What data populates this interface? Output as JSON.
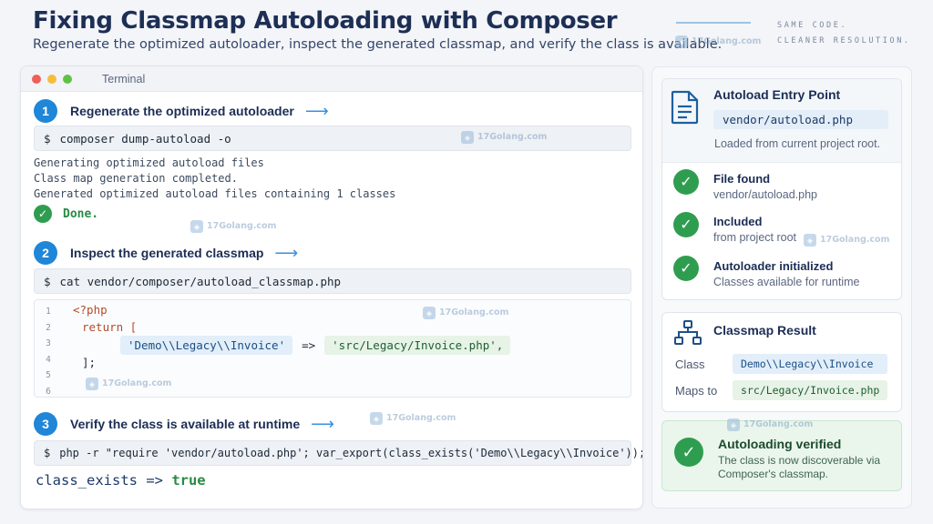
{
  "header": {
    "title": "Fixing Classmap Autoloading with Composer",
    "subtitle": "Regenerate the optimized autoloader, inspect the generated classmap, and verify the class is available.",
    "tagline_line1": "SAME CODE.",
    "tagline_line2": "CLEANER RESOLUTION."
  },
  "watermark": "17Golang.com",
  "terminal": {
    "title": "Terminal",
    "prompt": "$",
    "steps": [
      {
        "num": "1",
        "label": "Regenerate the optimized autoloader",
        "command": "composer dump-autoload -o"
      },
      {
        "num": "2",
        "label": "Inspect the generated classmap",
        "command": "cat vendor/composer/autoload_classmap.php"
      },
      {
        "num": "3",
        "label": "Verify the class is available at runtime",
        "command": "php -r \"require 'vendor/autoload.php'; var_export(class_exists('Demo\\\\Legacy\\\\Invoice'));\""
      }
    ],
    "output_lines": [
      "Generating optimized autoload files",
      "Class map generation completed.",
      "Generated optimized autoload files containing 1 classes"
    ],
    "done_label": "Done.",
    "code": {
      "line_numbers": [
        "1",
        "2",
        "3",
        "4",
        "5",
        "6"
      ],
      "line1": "<?php",
      "line2": "return [",
      "key": "'Demo\\\\Legacy\\\\Invoice'",
      "arrow": "=>",
      "value": "'src/Legacy/Invoice.php',",
      "line4": "];"
    },
    "result_prefix": "class_exists => ",
    "result_value": "true"
  },
  "entry_point": {
    "title": "Autoload Entry Point",
    "file": "vendor/autoload.php",
    "note": "Loaded from current project root.",
    "checks": [
      {
        "title": "File found",
        "detail": "vendor/autoload.php"
      },
      {
        "title": "Included",
        "detail": "from project root"
      },
      {
        "title": "Autoloader initialized",
        "detail": "Classes available for runtime"
      }
    ]
  },
  "classmap_result": {
    "title": "Classmap Result",
    "class_label": "Class",
    "class_value": "Demo\\\\Legacy\\\\Invoice",
    "maps_label": "Maps to",
    "maps_value": "src/Legacy/Invoice.php"
  },
  "verified": {
    "title": "Autoloading verified",
    "text": "The class is now discoverable via Composer's classmap."
  },
  "colors": {
    "accent": "#1f86d8",
    "success": "#2f9d4f",
    "key_chip": "#e2eef9",
    "value_chip": "#e6f3e6"
  }
}
